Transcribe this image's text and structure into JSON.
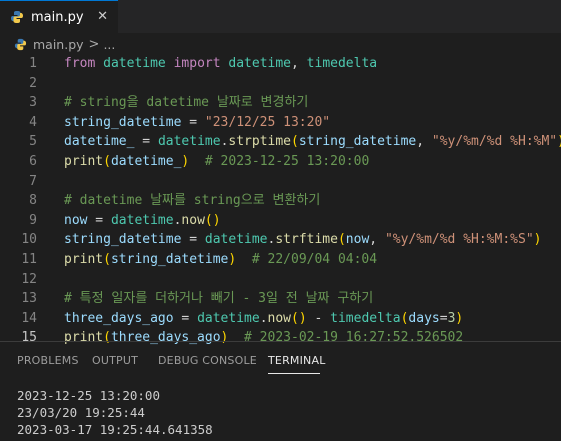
{
  "tab": {
    "filename": "main.py",
    "close": "✕"
  },
  "breadcrumb": {
    "file": "main.py",
    "separator": ">",
    "more": "..."
  },
  "editor": {
    "active_line": 15,
    "lines": [
      {
        "n": "1",
        "tokens": [
          [
            "kw",
            "from"
          ],
          [
            "op",
            " "
          ],
          [
            "cls",
            "datetime"
          ],
          [
            "op",
            " "
          ],
          [
            "kw",
            "import"
          ],
          [
            "op",
            " "
          ],
          [
            "cls",
            "datetime"
          ],
          [
            "op",
            ", "
          ],
          [
            "cls",
            "timedelta"
          ]
        ]
      },
      {
        "n": "2",
        "tokens": []
      },
      {
        "n": "3",
        "tokens": [
          [
            "com",
            "# string을 datetime 날짜로 변경하기"
          ]
        ]
      },
      {
        "n": "4",
        "tokens": [
          [
            "var",
            "string_datetime"
          ],
          [
            "op",
            " = "
          ],
          [
            "str",
            "\"23/12/25 13:20\""
          ]
        ]
      },
      {
        "n": "5",
        "tokens": [
          [
            "var",
            "datetime_"
          ],
          [
            "op",
            " = "
          ],
          [
            "cls",
            "datetime"
          ],
          [
            "op",
            "."
          ],
          [
            "fn",
            "strptime"
          ],
          [
            "br1",
            "("
          ],
          [
            "var",
            "string_datetime"
          ],
          [
            "op",
            ", "
          ],
          [
            "str",
            "\"%y/%m/%d %H:%M\""
          ],
          [
            "br1",
            ")"
          ]
        ]
      },
      {
        "n": "6",
        "tokens": [
          [
            "fn",
            "print"
          ],
          [
            "br1",
            "("
          ],
          [
            "var",
            "datetime_"
          ],
          [
            "br1",
            ")"
          ],
          [
            "op",
            "  "
          ],
          [
            "com",
            "# 2023-12-25 13:20:00"
          ]
        ]
      },
      {
        "n": "7",
        "tokens": []
      },
      {
        "n": "8",
        "tokens": [
          [
            "com",
            "# datetime 날짜를 string으로 변환하기"
          ]
        ]
      },
      {
        "n": "9",
        "tokens": [
          [
            "var",
            "now"
          ],
          [
            "op",
            " = "
          ],
          [
            "cls",
            "datetime"
          ],
          [
            "op",
            "."
          ],
          [
            "fn",
            "now"
          ],
          [
            "br1",
            "()"
          ]
        ]
      },
      {
        "n": "10",
        "tokens": [
          [
            "var",
            "string_datetime"
          ],
          [
            "op",
            " = "
          ],
          [
            "cls",
            "datetime"
          ],
          [
            "op",
            "."
          ],
          [
            "fn",
            "strftime"
          ],
          [
            "br1",
            "("
          ],
          [
            "var",
            "now"
          ],
          [
            "op",
            ", "
          ],
          [
            "str",
            "\"%y/%m/%d %H:%M:%S\""
          ],
          [
            "br1",
            ")"
          ]
        ]
      },
      {
        "n": "11",
        "tokens": [
          [
            "fn",
            "print"
          ],
          [
            "br1",
            "("
          ],
          [
            "var",
            "string_datetime"
          ],
          [
            "br1",
            ")"
          ],
          [
            "op",
            "  "
          ],
          [
            "com",
            "# 22/09/04 04:04"
          ]
        ]
      },
      {
        "n": "12",
        "tokens": []
      },
      {
        "n": "13",
        "tokens": [
          [
            "com",
            "# 특정 일자를 더하거나 빼기 - 3일 전 날짜 구하기"
          ]
        ]
      },
      {
        "n": "14",
        "tokens": [
          [
            "var",
            "three_days_ago"
          ],
          [
            "op",
            " = "
          ],
          [
            "cls",
            "datetime"
          ],
          [
            "op",
            "."
          ],
          [
            "fn",
            "now"
          ],
          [
            "br1",
            "()"
          ],
          [
            "op",
            " - "
          ],
          [
            "cls",
            "timedelta"
          ],
          [
            "br1",
            "("
          ],
          [
            "var",
            "days"
          ],
          [
            "op",
            "="
          ],
          [
            "num",
            "3"
          ],
          [
            "br1",
            ")"
          ]
        ]
      },
      {
        "n": "15",
        "tokens": [
          [
            "fn",
            "print"
          ],
          [
            "br1",
            "("
          ],
          [
            "var",
            "three_days_ago"
          ],
          [
            "br1",
            ")"
          ],
          [
            "op",
            "  "
          ],
          [
            "com",
            "# 2023-02-19 16:27:52.526502"
          ]
        ]
      }
    ]
  },
  "panel": {
    "tabs": [
      "PROBLEMS",
      "OUTPUT",
      "DEBUG CONSOLE",
      "TERMINAL"
    ],
    "active": "TERMINAL"
  },
  "terminal": {
    "lines": [
      "2023-12-25 13:20:00",
      "23/03/20 19:25:44",
      "2023-03-17 19:25:44.641358"
    ]
  },
  "colors": {
    "background": "#1e1e1e",
    "keyword": "#c586c0",
    "variable": "#9cdcfe",
    "class": "#4ec9b0",
    "function": "#dcdcaa",
    "string": "#ce9178",
    "number": "#b5cea8",
    "comment": "#6a9955"
  },
  "icons": {
    "file": "python-icon",
    "close": "close-icon"
  }
}
